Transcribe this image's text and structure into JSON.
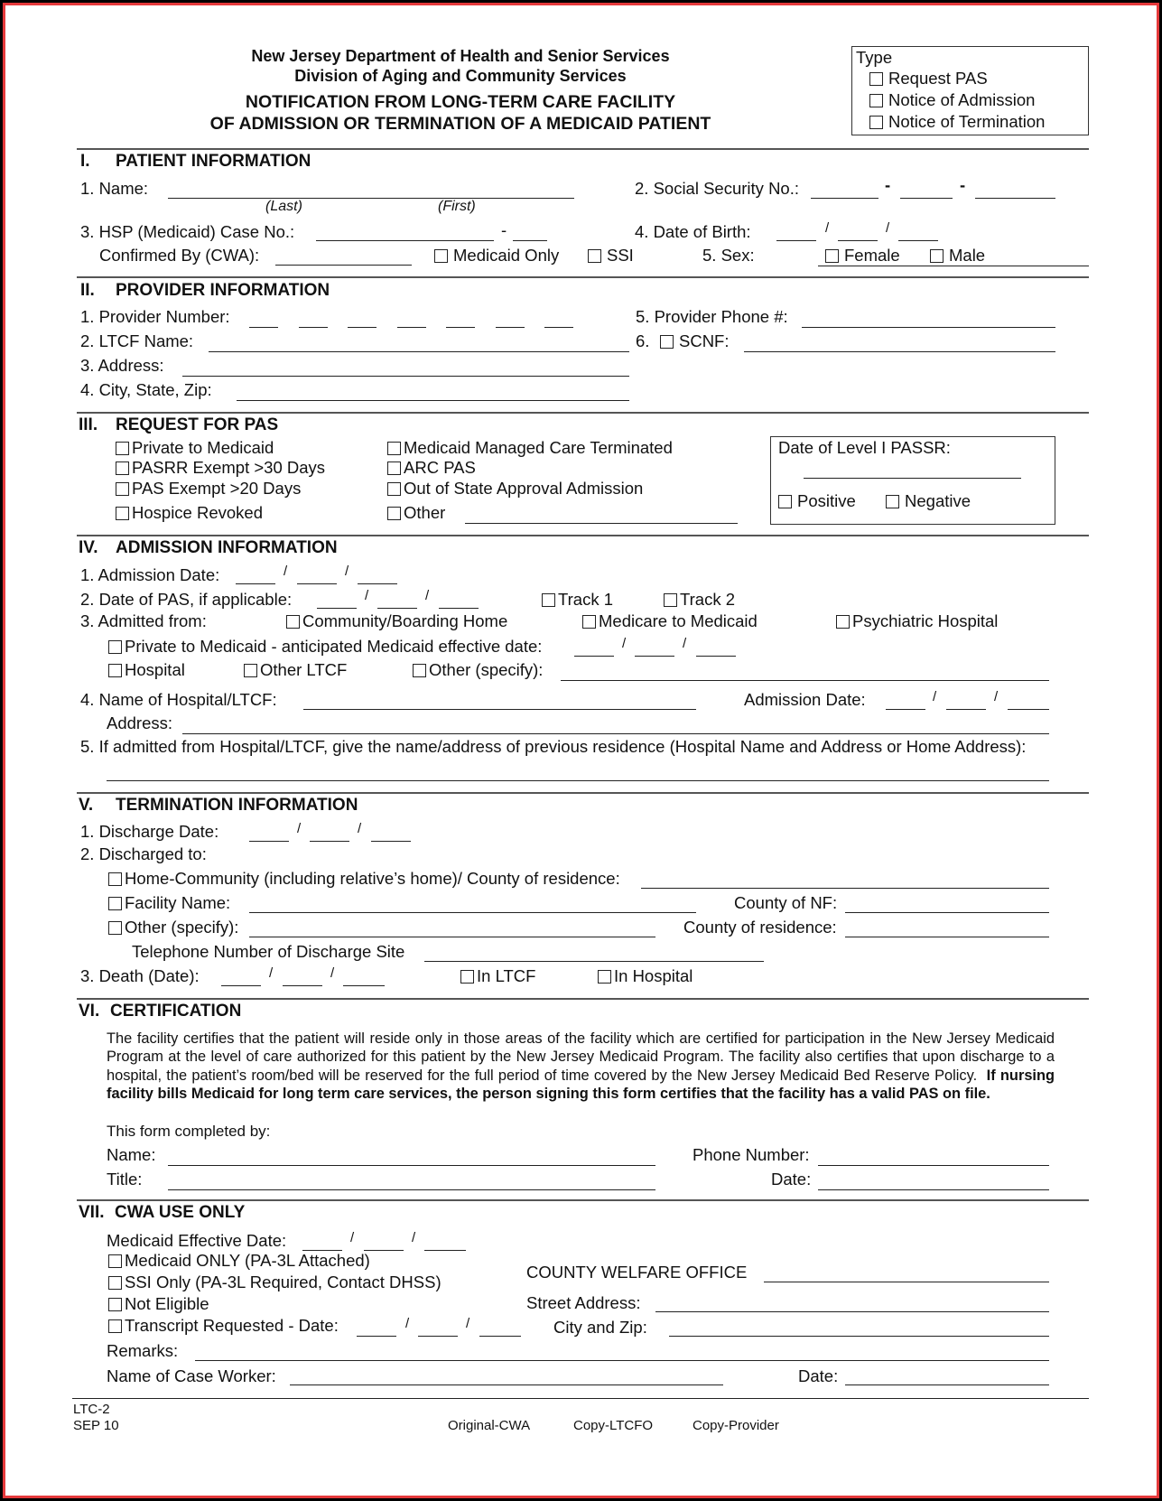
{
  "header": {
    "agency_line1": "New Jersey Department of Health and Senior Services",
    "agency_line2": "Division of Aging and Community Services",
    "title_line1": "NOTIFICATION FROM LONG-TERM CARE FACILITY",
    "title_line2": "OF ADMISSION OR TERMINATION OF A MEDICAID PATIENT"
  },
  "type_box": {
    "label": "Type",
    "options": [
      "Request PAS",
      "Notice of Admission",
      "Notice of Termination"
    ]
  },
  "patient": {
    "heading_num": "I.",
    "heading": "PATIENT INFORMATION",
    "name_label": "1.  Name:",
    "last_hint": "(Last)",
    "first_hint": "(First)",
    "ssn_label": "2. Social Security No.:",
    "dash": "-",
    "case_label": "3.  HSP (Medicaid) Case No.:",
    "dob_label": "4.  Date of Birth:",
    "slash": "/",
    "confirmed_label": "Confirmed By (CWA):",
    "medicaid_only": "Medicaid Only",
    "ssi": "SSI",
    "sex_label": "5.  Sex:",
    "female": "Female",
    "male": "Male"
  },
  "provider": {
    "heading_num": "II.",
    "heading": "PROVIDER INFORMATION",
    "number_label": "1.  Provider Number:",
    "ltcf_label": "2.  LTCF Name:",
    "address_label": "3.  Address:",
    "city_label": "4.  City, State, Zip:",
    "phone_label": "5.  Provider Phone #:",
    "scnf_num": "6.",
    "scnf_label": "SCNF:"
  },
  "pas": {
    "heading_num": "III.",
    "heading": "REQUEST FOR PAS",
    "left_options": [
      "Private to Medicaid",
      "PASRR Exempt >30 Days",
      "PAS Exempt >20 Days",
      "Hospice Revoked"
    ],
    "right_options": [
      "Medicaid Managed Care Terminated",
      "ARC PAS",
      "Out of State Approval Admission",
      "Other"
    ],
    "passr_label": "Date of Level I PASSR:",
    "positive": "Positive",
    "negative": "Negative"
  },
  "admission": {
    "heading_num": "IV.",
    "heading": "ADMISSION INFORMATION",
    "date_label": "1.  Admission Date:",
    "pas_date_label": "2.  Date of PAS, if applicable:",
    "track1": "Track 1",
    "track2": "Track 2",
    "from_label": "3.  Admitted from:",
    "community": "Community/Boarding Home",
    "medicare": "Medicare to Medicaid",
    "psych": "Psychiatric Hospital",
    "private": "Private to Medicaid - anticipated Medicaid effective date:",
    "hospital": "Hospital",
    "other_ltcf": "Other LTCF",
    "other_specify": "Other (specify):",
    "hosp_name_label": "4.  Name of Hospital/LTCF:",
    "adm_date_label": "Admission Date:",
    "address_label": "Address:",
    "prev_residence_label": "5.  If admitted from Hospital/LTCF, give the name/address of previous residence (Hospital Name and Address or Home Address):"
  },
  "termination": {
    "heading_num": "V.",
    "heading": "TERMINATION INFORMATION",
    "discharge_date_label": "1.  Discharge Date:",
    "discharged_to_label": "2.  Discharged to:",
    "home": "Home-Community (including relative’s home)/ County of residence:",
    "facility": "Facility Name:",
    "county_nf": "County of NF:",
    "other": "Other (specify):",
    "county_res": "County of residence:",
    "phone_label": "Telephone Number of Discharge Site",
    "death_label": "3.  Death (Date):",
    "in_ltcf": "In LTCF",
    "in_hospital": "In Hospital"
  },
  "certification": {
    "heading_num": "VI.",
    "heading": "CERTIFICATION",
    "paragraph": "The facility certifies that the patient will reside only in those areas of the facility which are certified for participation in the New Jersey Medicaid Program at the level of care authorized for this patient by the New Jersey Medicaid Program.  The facility also certifies that upon discharge to a hospital, the patient’s room/bed will be reserved for the full period of time covered by the New Jersey Medicaid Bed Reserve Policy.",
    "paragraph_bold": "If nursing facility bills Medicaid for long term care services, the person signing this form certifies that the facility has a valid PAS on file.",
    "completed_by": "This form completed by:",
    "name_label": "Name:",
    "title_label": "Title:",
    "phone_label": "Phone Number:",
    "date_label": "Date:"
  },
  "cwa": {
    "heading_num": "VII.",
    "heading": "CWA USE ONLY",
    "effective_label": "Medicaid Effective Date:",
    "options": [
      "Medicaid ONLY (PA-3L Attached)",
      "SSI Only (PA-3L Required, Contact DHSS)",
      "Not Eligible",
      "Transcript Requested - Date:"
    ],
    "county_office": "COUNTY WELFARE OFFICE",
    "street_label": "Street Address:",
    "city_label": "City and Zip:",
    "remarks_label": "Remarks:",
    "case_worker_label": "Name of Case Worker:",
    "date_label": "Date:"
  },
  "footer": {
    "form_id": "LTC-2",
    "revision": "SEP 10",
    "copies": [
      "Original-CWA",
      "Copy-LTCFO",
      "Copy-Provider"
    ]
  }
}
